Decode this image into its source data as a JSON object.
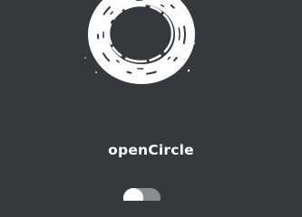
{
  "app": {
    "name": "openCircle",
    "logo_icon": "brush-circle-icon"
  },
  "toggle": {
    "state": "off"
  },
  "colors": {
    "background": "#35383d",
    "foreground": "#ffffff",
    "toggle_track": "#8a8d92"
  }
}
